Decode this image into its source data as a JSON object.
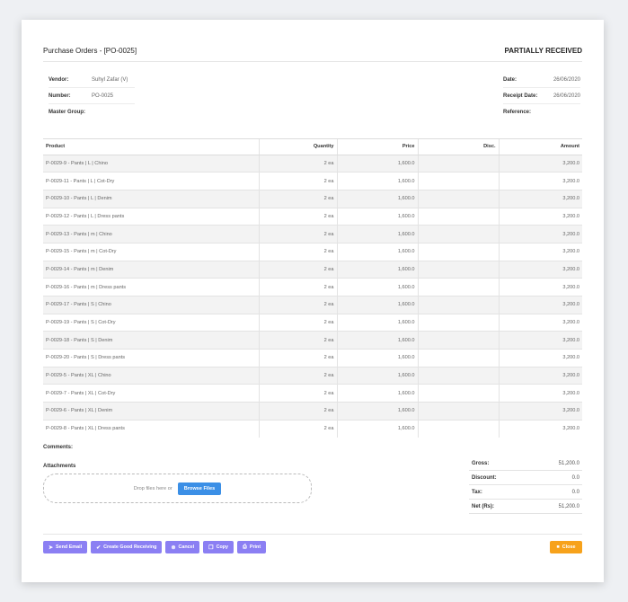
{
  "header": {
    "title": "Purchase Orders - [PO-0025]",
    "status": "PARTIALLY RECEIVED"
  },
  "info_left": [
    {
      "label": "Vendor:",
      "value": "Suhyl Zafar (V)"
    },
    {
      "label": "Number:",
      "value": "PO-0025"
    },
    {
      "label": "Master Group:",
      "value": ""
    }
  ],
  "info_right": [
    {
      "label": "Date:",
      "value": "26/06/2020"
    },
    {
      "label": "Receipt Date:",
      "value": "26/06/2020"
    },
    {
      "label": "Reference:",
      "value": ""
    }
  ],
  "table": {
    "columns": [
      "Product",
      "Quantity",
      "Price",
      "Disc.",
      "Amount"
    ],
    "rows": [
      [
        "P-0029-9 - Pants | L | Chino",
        "2 ea",
        "1,600.0",
        "",
        "3,200.0"
      ],
      [
        "P-0029-11 - Pants | L | Cot-Dry",
        "2 ea",
        "1,600.0",
        "",
        "3,200.0"
      ],
      [
        "P-0029-10 - Pants | L | Denim",
        "2 ea",
        "1,600.0",
        "",
        "3,200.0"
      ],
      [
        "P-0029-12 - Pants | L | Dress pants",
        "2 ea",
        "1,600.0",
        "",
        "3,200.0"
      ],
      [
        "P-0029-13 - Pants | m | Chino",
        "2 ea",
        "1,600.0",
        "",
        "3,200.0"
      ],
      [
        "P-0029-15 - Pants | m | Cot-Dry",
        "2 ea",
        "1,600.0",
        "",
        "3,200.0"
      ],
      [
        "P-0029-14 - Pants | m | Denim",
        "2 ea",
        "1,600.0",
        "",
        "3,200.0"
      ],
      [
        "P-0029-16 - Pants | m | Dress pants",
        "2 ea",
        "1,600.0",
        "",
        "3,200.0"
      ],
      [
        "P-0029-17 - Pants | S | Chino",
        "2 ea",
        "1,600.0",
        "",
        "3,200.0"
      ],
      [
        "P-0029-19 - Pants | S | Cot-Dry",
        "2 ea",
        "1,600.0",
        "",
        "3,200.0"
      ],
      [
        "P-0029-18 - Pants | S | Denim",
        "2 ea",
        "1,600.0",
        "",
        "3,200.0"
      ],
      [
        "P-0029-20 - Pants | S | Dress pants",
        "2 ea",
        "1,600.0",
        "",
        "3,200.0"
      ],
      [
        "P-0029-5 - Pants | XL | Chino",
        "2 ea",
        "1,600.0",
        "",
        "3,200.0"
      ],
      [
        "P-0029-7 - Pants | XL | Cot-Dry",
        "2 ea",
        "1,600.0",
        "",
        "3,200.0"
      ],
      [
        "P-0029-6 - Pants | XL | Denim",
        "2 ea",
        "1,600.0",
        "",
        "3,200.0"
      ],
      [
        "P-0029-8 - Pants | XL | Dress pants",
        "2 ea",
        "1,600.0",
        "",
        "3,200.0"
      ]
    ]
  },
  "comments_label": "Comments:",
  "attachments": {
    "label": "Attachments",
    "drop_text": "Drop files here or",
    "browse_label": "Browse Files"
  },
  "totals": [
    {
      "label": "Gross:",
      "value": "51,200.0"
    },
    {
      "label": "Discount:",
      "value": "0.0"
    },
    {
      "label": "Tax:",
      "value": "0.0"
    },
    {
      "label": "Net (Rs):",
      "value": "51,200.0"
    }
  ],
  "actions": [
    {
      "icon": "paper-plane-icon",
      "glyph": "➤",
      "label": "Send Email"
    },
    {
      "icon": "check-icon",
      "glyph": "✔",
      "label": "Create Good Receiving"
    },
    {
      "icon": "cancel-icon",
      "glyph": "⊗",
      "label": "Cancel"
    },
    {
      "icon": "copy-icon",
      "glyph": "❐",
      "label": "Copy"
    },
    {
      "icon": "print-icon",
      "glyph": "⎙",
      "label": "Print"
    }
  ],
  "close": {
    "glyph": "■",
    "label": "Close"
  },
  "colors": {
    "action": "#8b7ff3",
    "close": "#f7a21b",
    "browse": "#3b8fe6"
  }
}
